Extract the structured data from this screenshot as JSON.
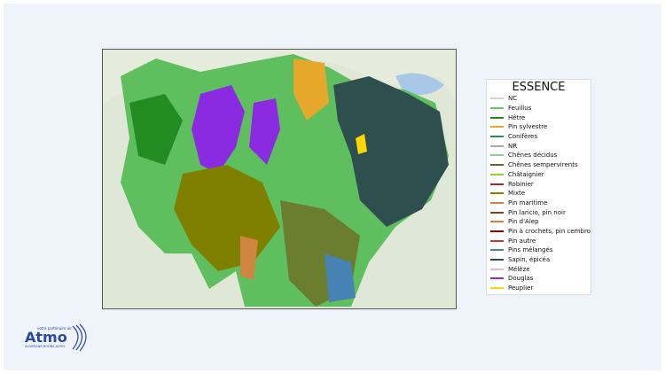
{
  "legend": {
    "title": "ESSENCE",
    "items": [
      {
        "label": "NC",
        "color": "#d3d3d3"
      },
      {
        "label": "Feuillus",
        "color": "#66cc66"
      },
      {
        "label": "Hêtre",
        "color": "#228b22"
      },
      {
        "label": "Pin sylvestre",
        "color": "#e6a82a"
      },
      {
        "label": "Conifères",
        "color": "#2e8b57"
      },
      {
        "label": "NR",
        "color": "#a9a9a9"
      },
      {
        "label": "Chênes décidus",
        "color": "#8fcf8f"
      },
      {
        "label": "Chênes sempervirents",
        "color": "#556b2f"
      },
      {
        "label": "Châtaignier",
        "color": "#9acd32"
      },
      {
        "label": "Robinier",
        "color": "#b22222"
      },
      {
        "label": "Mixte",
        "color": "#808000"
      },
      {
        "label": "Pin maritime",
        "color": "#cd853f"
      },
      {
        "label": "Pin laricio, pin noir",
        "color": "#8b4513"
      },
      {
        "label": "Pin d'Alep",
        "color": "#e07b39"
      },
      {
        "label": "Pin à crochets, pin cembro",
        "color": "#8b0000"
      },
      {
        "label": "Pin autre",
        "color": "#c0392b"
      },
      {
        "label": "Pins mélangés",
        "color": "#4682b4"
      },
      {
        "label": "Sapin, épicéa",
        "color": "#2f4f4f"
      },
      {
        "label": "Mélèze",
        "color": "#d8bfd8"
      },
      {
        "label": "Douglas",
        "color": "#8a2be2"
      },
      {
        "label": "Peuplier",
        "color": "#ffd700"
      }
    ]
  },
  "logo": {
    "tagline": "votre partenaire air",
    "name": "Atmo",
    "region": "AUVERGNE-RHÔNE-ALPES",
    "color": "#2b4ba0"
  }
}
